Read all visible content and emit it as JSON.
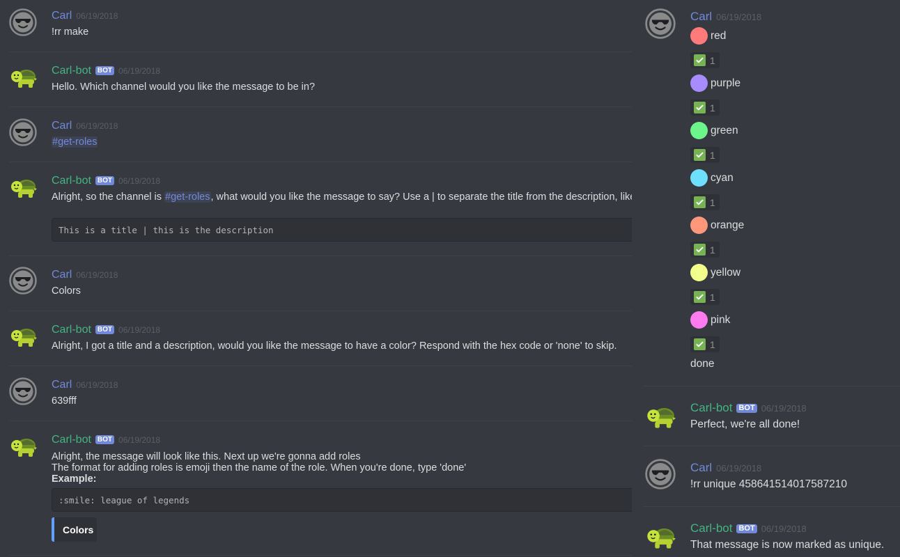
{
  "colors": {
    "background": "#36393f",
    "user_name": "#7289da",
    "bot_name": "#43b581",
    "bot_tag": "#7289da",
    "embed_accent": "#639fff",
    "reaction_check": "#77b255"
  },
  "left_messages": [
    {
      "author": "Carl",
      "is_bot": false,
      "timestamp": "06/19/2018",
      "text": "!rr make"
    },
    {
      "author": "Carl-bot",
      "is_bot": true,
      "bot_tag": "BOT",
      "timestamp": "06/19/2018",
      "text": "Hello. Which channel would you like the message to be in?"
    },
    {
      "author": "Carl",
      "is_bot": false,
      "timestamp": "06/19/2018",
      "mention": "#get-roles"
    },
    {
      "author": "Carl-bot",
      "is_bot": true,
      "bot_tag": "BOT",
      "timestamp": "06/19/2018",
      "text_before": "Alright, so the channel is ",
      "mention": "#get-roles",
      "text_after": ", what would you like the message to say? Use a | to separate the title from the description, like so",
      "code": "This is a title | this is the description"
    },
    {
      "author": "Carl",
      "is_bot": false,
      "timestamp": "06/19/2018",
      "text": "Colors"
    },
    {
      "author": "Carl-bot",
      "is_bot": true,
      "bot_tag": "BOT",
      "timestamp": "06/19/2018",
      "text": "Alright, I got a title and a description, would you like the message to have a color? Respond with the hex code or 'none' to skip."
    },
    {
      "author": "Carl",
      "is_bot": false,
      "timestamp": "06/19/2018",
      "text": "639fff"
    },
    {
      "author": "Carl-bot",
      "is_bot": true,
      "bot_tag": "BOT",
      "timestamp": "06/19/2018",
      "line1": "Alright, the message will look like this. Next up we're gonna add roles",
      "line2": "The format for adding roles is emoji then the name of the role. When you're done, type 'done'",
      "bold": "Example:",
      "code": ":smile: league of legends",
      "embed_title": "Colors"
    }
  ],
  "right_messages": {
    "roles_message": {
      "author": "Carl",
      "timestamp": "06/19/2018",
      "roles": [
        {
          "name": "red",
          "color": "#ff7b7b",
          "reaction_count": "1"
        },
        {
          "name": "purple",
          "color": "#a88bff",
          "reaction_count": "1"
        },
        {
          "name": "green",
          "color": "#6bf58a",
          "reaction_count": "1"
        },
        {
          "name": "cyan",
          "color": "#6ee0ff",
          "reaction_count": "1"
        },
        {
          "name": "orange",
          "color": "#ff977b",
          "reaction_count": "1"
        },
        {
          "name": "yellow",
          "color": "#f2ff8a",
          "reaction_count": "1"
        },
        {
          "name": "pink",
          "color": "#ff7bef",
          "reaction_count": "1"
        }
      ],
      "done": "done"
    },
    "done_reply": {
      "author": "Carl-bot",
      "bot_tag": "BOT",
      "timestamp": "06/19/2018",
      "text": "Perfect, we're all done!"
    },
    "unique_cmd": {
      "author": "Carl",
      "timestamp": "06/19/2018",
      "text": "!rr unique 458641514017587210"
    },
    "unique_reply": {
      "author": "Carl-bot",
      "bot_tag": "BOT",
      "timestamp": "06/19/2018",
      "text": "That message is now marked as unique."
    }
  }
}
